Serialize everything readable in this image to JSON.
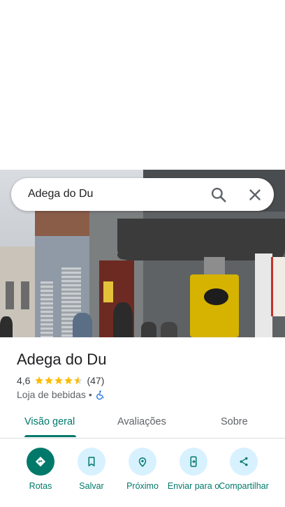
{
  "search": {
    "query": "Adega do Du"
  },
  "place": {
    "name": "Adega do Du",
    "rating": "4,6",
    "rating_value": 4.6,
    "review_count": "(47)",
    "category": "Loja de bebidas",
    "separator": "•"
  },
  "tabs": [
    {
      "label": "Visão geral",
      "active": true
    },
    {
      "label": "Avaliações",
      "active": false
    },
    {
      "label": "Sobre",
      "active": false
    }
  ],
  "actions": [
    {
      "label": "Rotas",
      "icon": "directions-icon"
    },
    {
      "label": "Salvar",
      "icon": "bookmark-icon"
    },
    {
      "label": "Próximo",
      "icon": "nearby-icon"
    },
    {
      "label": "Enviar para o",
      "icon": "send-to-phone-icon"
    },
    {
      "label": "Compartilhar",
      "icon": "share-icon"
    }
  ],
  "colors": {
    "accent": "#00796b",
    "action_bg": "#d7f1ff",
    "star": "#fbbc04"
  }
}
